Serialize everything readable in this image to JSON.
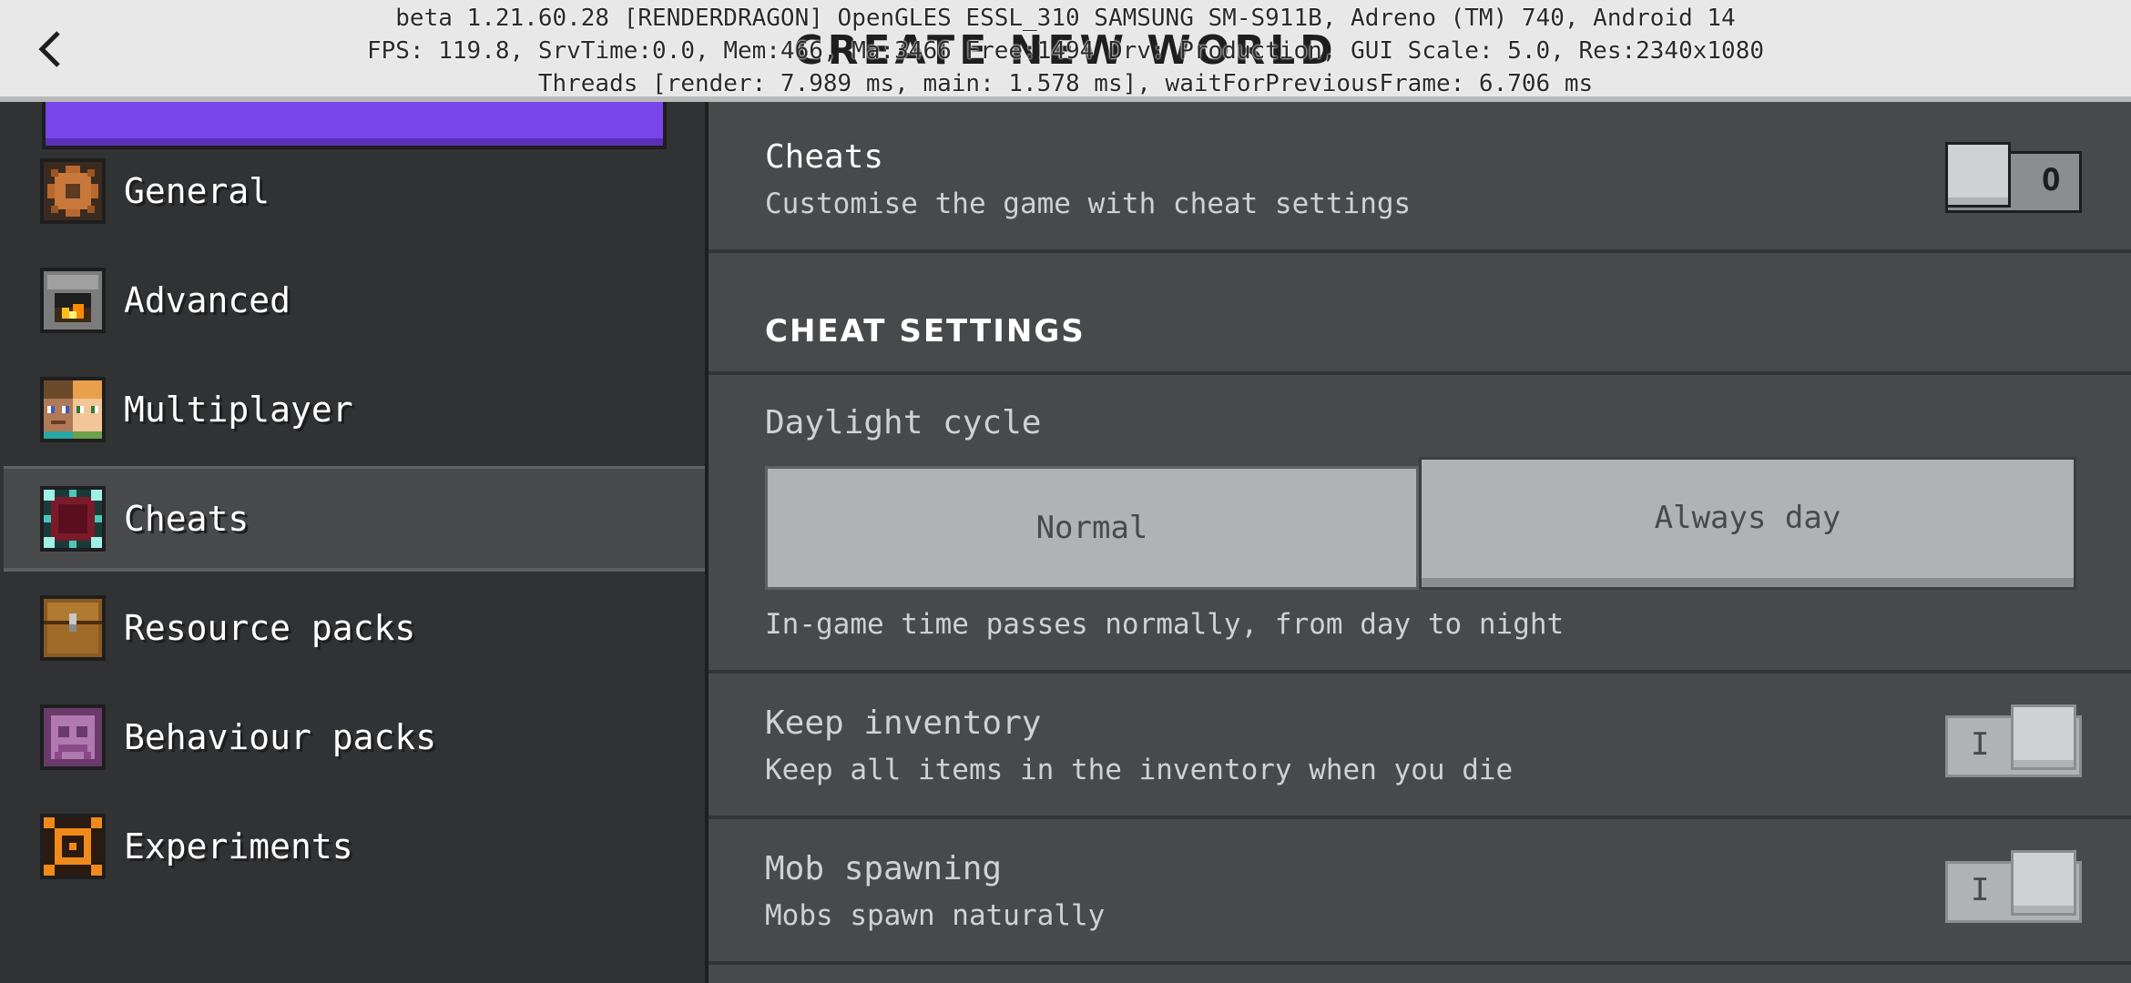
{
  "header": {
    "title": "CREATE NEW WORLD",
    "back_label": "<",
    "debug_lines": [
      "beta 1.21.60.28 [RENDERDRAGON] OpenGLES ESSL_310 SAMSUNG SM-S911B, Adreno (TM) 740, Android 14",
      "FPS: 119.8, SrvTime:0.0, Mem:466, Ma:3466 Free:1494 Drv: Production, GUI Scale: 5.0, Res:2340x1080",
      "Threads [render: 7.989 ms, main: 1.578 ms], waitForPreviousFrame: 6.706 ms"
    ]
  },
  "sidebar": {
    "items": [
      {
        "label": "General",
        "icon": "gear-icon"
      },
      {
        "label": "Advanced",
        "icon": "furnace-icon"
      },
      {
        "label": "Multiplayer",
        "icon": "players-icon"
      },
      {
        "label": "Cheats",
        "icon": "cheats-icon",
        "selected": true
      },
      {
        "label": "Resource packs",
        "icon": "chest-icon"
      },
      {
        "label": "Behaviour packs",
        "icon": "behaviour-pack-icon"
      },
      {
        "label": "Experiments",
        "icon": "experiments-icon"
      }
    ]
  },
  "main": {
    "cheats": {
      "title": "Cheats",
      "description": "Customise the game with cheat settings",
      "toggle_state": "off",
      "toggle_mark": "O"
    },
    "section_title": "CHEAT SETTINGS",
    "daylight": {
      "title": "Daylight cycle",
      "options": [
        "Normal",
        "Always day"
      ],
      "selected": "Normal",
      "description": "In-game time passes normally, from day to night"
    },
    "keep_inventory": {
      "title": "Keep inventory",
      "description": "Keep all items in the inventory when you die",
      "toggle_state": "on",
      "toggle_mark": "I"
    },
    "mob_spawning": {
      "title": "Mob spawning",
      "description": "Mobs spawn naturally",
      "toggle_state": "on",
      "toggle_mark": "I"
    }
  },
  "colors": {
    "accent_purple": "#7a45e8",
    "panel_dark": "#313233",
    "panel_mid": "#48494b",
    "button_grey": "#b1b2b5"
  }
}
